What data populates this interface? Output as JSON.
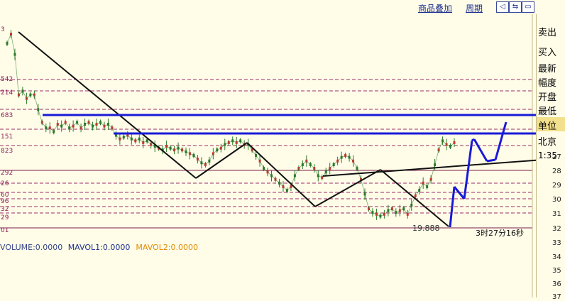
{
  "toolbar": {
    "overlay_link": "商品叠加",
    "period_link": "周期",
    "btn_left": "◁",
    "btn_split": "⇆",
    "btn_box": "▭"
  },
  "sidebar": {
    "sell": "卖出",
    "buy": "买入",
    "latest": "最新",
    "change": "幅度",
    "open": "开盘",
    "low": "最低",
    "unit": "单位",
    "region": "北京",
    "time_partial": "1:35"
  },
  "chart_data": {
    "type": "line",
    "y_axis": {
      "ticks_right": [
        "27",
        "28",
        "29",
        "30",
        "31",
        "32",
        "33",
        "34",
        "35",
        "36",
        "37"
      ],
      "ticks_left": [
        "3",
        "542",
        "214",
        "683",
        "151",
        "823",
        "292",
        "26",
        "60",
        "96",
        "32",
        "29",
        "01"
      ],
      "range_pct": [
        0.87,
        37
      ]
    },
    "price_series": {
      "color": "#2a7a2a",
      "values": [
        0.88,
        0.93,
        0.82,
        0.6,
        0.62,
        0.58,
        0.6,
        0.6,
        0.52,
        0.45,
        0.42,
        0.42,
        0.4,
        0.44,
        0.43,
        0.45,
        0.42,
        0.43,
        0.45,
        0.42,
        0.44,
        0.45,
        0.43,
        0.44,
        0.45,
        0.43,
        0.44,
        0.42,
        0.38,
        0.36,
        0.37,
        0.38,
        0.36,
        0.35,
        0.36,
        0.34,
        0.35,
        0.33,
        0.32,
        0.31,
        0.3,
        0.32,
        0.31,
        0.3,
        0.31,
        0.3,
        0.29,
        0.28,
        0.27,
        0.25,
        0.23,
        0.22,
        0.24,
        0.28,
        0.3,
        0.31,
        0.33,
        0.34,
        0.35,
        0.34,
        0.35,
        0.33,
        0.33,
        0.3,
        0.27,
        0.24,
        0.2,
        0.18,
        0.16,
        0.14,
        0.12,
        0.1,
        0.08,
        0.1,
        0.16,
        0.2,
        0.22,
        0.24,
        0.22,
        0.2,
        0.16,
        0.15,
        0.18,
        0.2,
        0.22,
        0.24,
        0.26,
        0.27,
        0.26,
        0.24,
        0.2,
        0.14,
        0.06,
        -0.02,
        -0.04,
        -0.05,
        -0.06,
        -0.05,
        -0.03,
        -0.02,
        -0.04,
        -0.03,
        -0.02,
        -0.05,
        0.0,
        0.05,
        0.08,
        0.12,
        0.1,
        0.14,
        0.22,
        0.3,
        0.35,
        0.33,
        0.32,
        0.34
      ]
    },
    "price_labels": [
      {
        "text": "19.888"
      }
    ],
    "time_label": "3时27分16秒",
    "indicators": [
      {
        "name": "VOLUME",
        "text": "VOLUME:0.0000",
        "color": "#334488"
      },
      {
        "name": "MAVOL1",
        "text": "MAVOL1:0.0000",
        "color": "#1b2d8c"
      },
      {
        "name": "MAVOL2",
        "text": "MAVOL2:0.0000",
        "color": "#e08a00"
      }
    ],
    "grid": true
  }
}
